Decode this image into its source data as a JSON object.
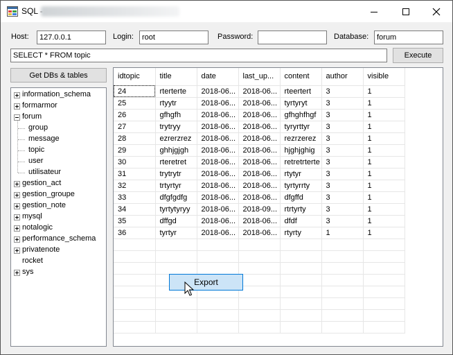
{
  "window": {
    "title": "SQL -",
    "icon": "app-icon",
    "controls": [
      "minimize-icon",
      "maximize-icon",
      "close-icon"
    ]
  },
  "connection": {
    "host_label": "Host:",
    "host_value": "127.0.0.1",
    "login_label": "Login:",
    "login_value": "root",
    "password_label": "Password:",
    "password_value": "",
    "database_label": "Database:",
    "database_value": "forum"
  },
  "query": {
    "text": "SELECT * FROM topic",
    "execute_label": "Execute"
  },
  "get_dbs_label": "Get DBs & tables",
  "tree": [
    {
      "label": "information_schema",
      "expander": "plus",
      "level": 0
    },
    {
      "label": "formarmor",
      "expander": "plus",
      "level": 0
    },
    {
      "label": "forum",
      "expander": "minus",
      "level": 0
    },
    {
      "label": "group",
      "expander": "none",
      "level": 1
    },
    {
      "label": "message",
      "expander": "none",
      "level": 1
    },
    {
      "label": "topic",
      "expander": "none",
      "level": 1
    },
    {
      "label": "user",
      "expander": "none",
      "level": 1
    },
    {
      "label": "utilisateur",
      "expander": "none",
      "level": 1
    },
    {
      "label": "gestion_act",
      "expander": "plus",
      "level": 0
    },
    {
      "label": "gestion_groupe",
      "expander": "plus",
      "level": 0
    },
    {
      "label": "gestion_note",
      "expander": "plus",
      "level": 0
    },
    {
      "label": "mysql",
      "expander": "plus",
      "level": 0
    },
    {
      "label": "notalogic",
      "expander": "plus",
      "level": 0
    },
    {
      "label": "performance_schema",
      "expander": "plus",
      "level": 0
    },
    {
      "label": "privatenote",
      "expander": "plus",
      "level": 0
    },
    {
      "label": "rocket",
      "expander": "none",
      "level": 0
    },
    {
      "label": "sys",
      "expander": "plus",
      "level": 0
    }
  ],
  "grid": {
    "columns": [
      "idtopic",
      "title",
      "date",
      "last_up...",
      "content",
      "author",
      "visible"
    ],
    "rows": [
      [
        "24",
        "rterterte",
        "2018-06...",
        "2018-06...",
        "rteertert",
        "3",
        "1"
      ],
      [
        "25",
        "rtyytr",
        "2018-06...",
        "2018-06...",
        "tyrtyryt",
        "3",
        "1"
      ],
      [
        "26",
        "gfhgfh",
        "2018-06...",
        "2018-06...",
        "gfhghfhgf",
        "3",
        "1"
      ],
      [
        "27",
        "trytryy",
        "2018-06...",
        "2018-06...",
        "tyryrttyr",
        "3",
        "1"
      ],
      [
        "28",
        "ezrerzrez",
        "2018-06...",
        "2018-06...",
        "rezrzerez",
        "3",
        "1"
      ],
      [
        "29",
        "ghhjgjgh",
        "2018-06...",
        "2018-06...",
        "hjghjghig",
        "3",
        "1"
      ],
      [
        "30",
        "rteretret",
        "2018-06...",
        "2018-06...",
        "retretrterte",
        "3",
        "1"
      ],
      [
        "31",
        "trytrytr",
        "2018-06...",
        "2018-06...",
        "rtytyr",
        "3",
        "1"
      ],
      [
        "32",
        "trtyrtyr",
        "2018-06...",
        "2018-06...",
        "tyrtyrrty",
        "3",
        "1"
      ],
      [
        "33",
        "dfgfgdfg",
        "2018-06...",
        "2018-06...",
        "dfgffd",
        "3",
        "1"
      ],
      [
        "34",
        "tyrtytyryy",
        "2018-06...",
        "2018-09...",
        "rtrtyrty",
        "3",
        "1"
      ],
      [
        "35",
        "dffgd",
        "2018-06...",
        "2018-06...",
        "dfdf",
        "3",
        "1"
      ],
      [
        "36",
        "tyrtyr",
        "2018-06...",
        "2018-06...",
        "rtyrty",
        "1",
        "1"
      ]
    ],
    "selected_row": 0
  },
  "export_label": "Export",
  "colors": {
    "window_bg": "#f0f0f0",
    "export_bg": "#cce4f7",
    "export_border": "#0078d7"
  }
}
